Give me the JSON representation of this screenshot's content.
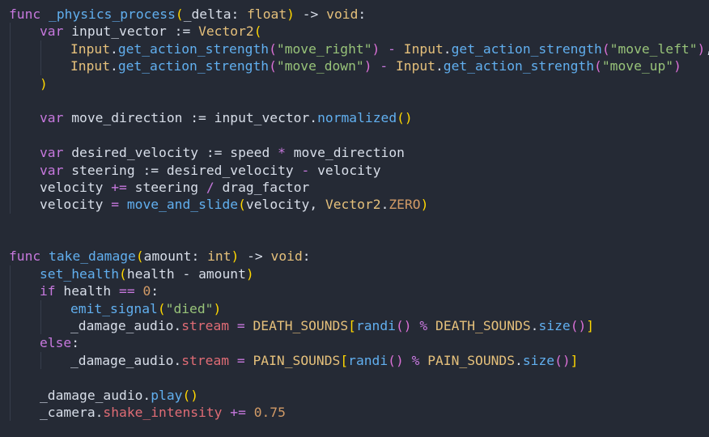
{
  "language": "GDScript",
  "colors": {
    "background": "#252a35",
    "text": "#d8dee9",
    "keyword": "#c678dd",
    "function": "#61afef",
    "type": "#e5c07b",
    "string": "#98c379",
    "number": "#d19a66",
    "property": "#e06c75"
  },
  "lines": [
    {
      "indent": 0,
      "tokens": [
        [
          "kw",
          "func"
        ],
        [
          "plain",
          " "
        ],
        [
          "fn",
          "_physics_process"
        ],
        [
          "brk1",
          "("
        ],
        [
          "plain",
          "_delta: "
        ],
        [
          "ty",
          "float"
        ],
        [
          "brk1",
          ")"
        ],
        [
          "plain",
          " -> "
        ],
        [
          "ty",
          "void"
        ],
        [
          "plain",
          ":"
        ]
      ]
    },
    {
      "indent": 1,
      "tokens": [
        [
          "kw",
          "var"
        ],
        [
          "plain",
          " input_vector := "
        ],
        [
          "ty",
          "Vector2"
        ],
        [
          "brk1",
          "("
        ]
      ]
    },
    {
      "indent": 2,
      "tokens": [
        [
          "ty",
          "Input"
        ],
        [
          "plain",
          "."
        ],
        [
          "fn",
          "get_action_strength"
        ],
        [
          "brk2",
          "("
        ],
        [
          "str",
          "\"move_right\""
        ],
        [
          "brk2",
          ")"
        ],
        [
          "plain",
          " "
        ],
        [
          "op",
          "-"
        ],
        [
          "plain",
          " "
        ],
        [
          "ty",
          "Input"
        ],
        [
          "plain",
          "."
        ],
        [
          "fn",
          "get_action_strength"
        ],
        [
          "brk2",
          "("
        ],
        [
          "str",
          "\"move_left\""
        ],
        [
          "brk2",
          ")"
        ],
        [
          "plain",
          ","
        ]
      ]
    },
    {
      "indent": 2,
      "tokens": [
        [
          "ty",
          "Input"
        ],
        [
          "plain",
          "."
        ],
        [
          "fn",
          "get_action_strength"
        ],
        [
          "brk2",
          "("
        ],
        [
          "str",
          "\"move_down\""
        ],
        [
          "brk2",
          ")"
        ],
        [
          "plain",
          " "
        ],
        [
          "op",
          "-"
        ],
        [
          "plain",
          " "
        ],
        [
          "ty",
          "Input"
        ],
        [
          "plain",
          "."
        ],
        [
          "fn",
          "get_action_strength"
        ],
        [
          "brk2",
          "("
        ],
        [
          "str",
          "\"move_up\""
        ],
        [
          "brk2",
          ")"
        ]
      ]
    },
    {
      "indent": 1,
      "tokens": [
        [
          "brk1",
          ")"
        ]
      ]
    },
    {
      "indent": 1,
      "tokens": []
    },
    {
      "indent": 1,
      "tokens": [
        [
          "kw",
          "var"
        ],
        [
          "plain",
          " move_direction := input_vector."
        ],
        [
          "fn",
          "normalized"
        ],
        [
          "brk1",
          "()"
        ]
      ]
    },
    {
      "indent": 1,
      "tokens": []
    },
    {
      "indent": 1,
      "tokens": [
        [
          "kw",
          "var"
        ],
        [
          "plain",
          " desired_velocity := speed "
        ],
        [
          "op",
          "*"
        ],
        [
          "plain",
          " move_direction"
        ]
      ]
    },
    {
      "indent": 1,
      "tokens": [
        [
          "kw",
          "var"
        ],
        [
          "plain",
          " steering := desired_velocity "
        ],
        [
          "op",
          "-"
        ],
        [
          "plain",
          " velocity"
        ]
      ]
    },
    {
      "indent": 1,
      "tokens": [
        [
          "plain",
          "velocity "
        ],
        [
          "op",
          "+="
        ],
        [
          "plain",
          " steering "
        ],
        [
          "op",
          "/"
        ],
        [
          "plain",
          " drag_factor"
        ]
      ]
    },
    {
      "indent": 1,
      "tokens": [
        [
          "plain",
          "velocity "
        ],
        [
          "op",
          "="
        ],
        [
          "plain",
          " "
        ],
        [
          "fn",
          "move_and_slide"
        ],
        [
          "brk1",
          "("
        ],
        [
          "plain",
          "velocity, "
        ],
        [
          "ty",
          "Vector2"
        ],
        [
          "plain",
          "."
        ],
        [
          "num",
          "ZERO"
        ],
        [
          "brk1",
          ")"
        ]
      ]
    },
    {
      "indent": 0,
      "tokens": []
    },
    {
      "indent": 0,
      "tokens": []
    },
    {
      "indent": 0,
      "tokens": [
        [
          "kw",
          "func"
        ],
        [
          "plain",
          " "
        ],
        [
          "fn",
          "take_damage"
        ],
        [
          "brk1",
          "("
        ],
        [
          "plain",
          "amount: "
        ],
        [
          "ty",
          "int"
        ],
        [
          "brk1",
          ")"
        ],
        [
          "plain",
          " -> "
        ],
        [
          "ty",
          "void"
        ],
        [
          "plain",
          ":"
        ]
      ]
    },
    {
      "indent": 1,
      "tokens": [
        [
          "fn",
          "set_health"
        ],
        [
          "brk1",
          "("
        ],
        [
          "plain",
          "health - amount"
        ],
        [
          "brk1",
          ")"
        ]
      ]
    },
    {
      "indent": 1,
      "tokens": [
        [
          "kw",
          "if"
        ],
        [
          "plain",
          " health "
        ],
        [
          "op",
          "=="
        ],
        [
          "plain",
          " "
        ],
        [
          "num",
          "0"
        ],
        [
          "plain",
          ":"
        ]
      ]
    },
    {
      "indent": 2,
      "tokens": [
        [
          "fn",
          "emit_signal"
        ],
        [
          "brk1",
          "("
        ],
        [
          "str",
          "\"died\""
        ],
        [
          "brk1",
          ")"
        ]
      ]
    },
    {
      "indent": 2,
      "tokens": [
        [
          "plain",
          "_damage_audio."
        ],
        [
          "prop",
          "stream"
        ],
        [
          "plain",
          " "
        ],
        [
          "op",
          "="
        ],
        [
          "plain",
          " "
        ],
        [
          "const",
          "DEATH_SOUNDS"
        ],
        [
          "brk1",
          "["
        ],
        [
          "fn",
          "randi"
        ],
        [
          "brk2",
          "()"
        ],
        [
          "plain",
          " "
        ],
        [
          "op",
          "%"
        ],
        [
          "plain",
          " "
        ],
        [
          "const",
          "DEATH_SOUNDS"
        ],
        [
          "plain",
          "."
        ],
        [
          "fn",
          "size"
        ],
        [
          "brk2",
          "()"
        ],
        [
          "brk1",
          "]"
        ]
      ]
    },
    {
      "indent": 1,
      "tokens": [
        [
          "kw",
          "else"
        ],
        [
          "plain",
          ":"
        ]
      ]
    },
    {
      "indent": 2,
      "tokens": [
        [
          "plain",
          "_damage_audio."
        ],
        [
          "prop",
          "stream"
        ],
        [
          "plain",
          " "
        ],
        [
          "op",
          "="
        ],
        [
          "plain",
          " "
        ],
        [
          "const",
          "PAIN_SOUNDS"
        ],
        [
          "brk1",
          "["
        ],
        [
          "fn",
          "randi"
        ],
        [
          "brk2",
          "()"
        ],
        [
          "plain",
          " "
        ],
        [
          "op",
          "%"
        ],
        [
          "plain",
          " "
        ],
        [
          "const",
          "PAIN_SOUNDS"
        ],
        [
          "plain",
          "."
        ],
        [
          "fn",
          "size"
        ],
        [
          "brk2",
          "()"
        ],
        [
          "brk1",
          "]"
        ]
      ]
    },
    {
      "indent": 1,
      "tokens": []
    },
    {
      "indent": 1,
      "tokens": [
        [
          "plain",
          "_damage_audio."
        ],
        [
          "fn",
          "play"
        ],
        [
          "brk1",
          "()"
        ]
      ]
    },
    {
      "indent": 1,
      "tokens": [
        [
          "plain",
          "_camera."
        ],
        [
          "prop",
          "shake_intensity"
        ],
        [
          "plain",
          " "
        ],
        [
          "op",
          "+="
        ],
        [
          "plain",
          " "
        ],
        [
          "num",
          "0.75"
        ]
      ]
    }
  ]
}
